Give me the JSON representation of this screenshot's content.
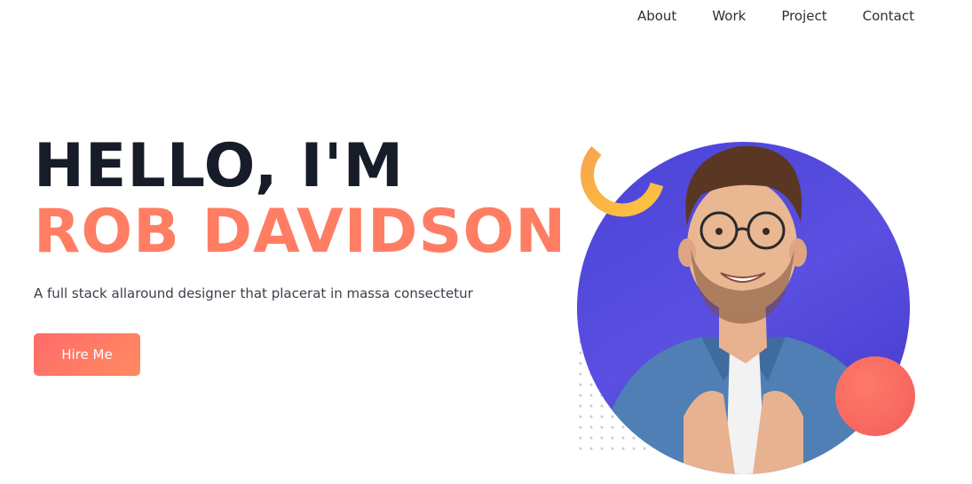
{
  "nav": {
    "items": [
      {
        "label": "About"
      },
      {
        "label": "Work"
      },
      {
        "label": "Project"
      },
      {
        "label": "Contact"
      }
    ]
  },
  "hero": {
    "greeting": "HELLO, I'M",
    "name": "ROB DAVIDSON",
    "tagline": "A full stack allaround designer that placerat in massa consectetur",
    "cta_label": "Hire Me"
  },
  "colors": {
    "accent": "#ff7d63",
    "heading": "#161c28",
    "circle": "#4b44d8",
    "ring": "#f7b044",
    "coral": "#f86862"
  },
  "icons": {
    "ring": "ring-shape",
    "dots": "dot-grid-pattern",
    "coral": "circle-shape"
  }
}
